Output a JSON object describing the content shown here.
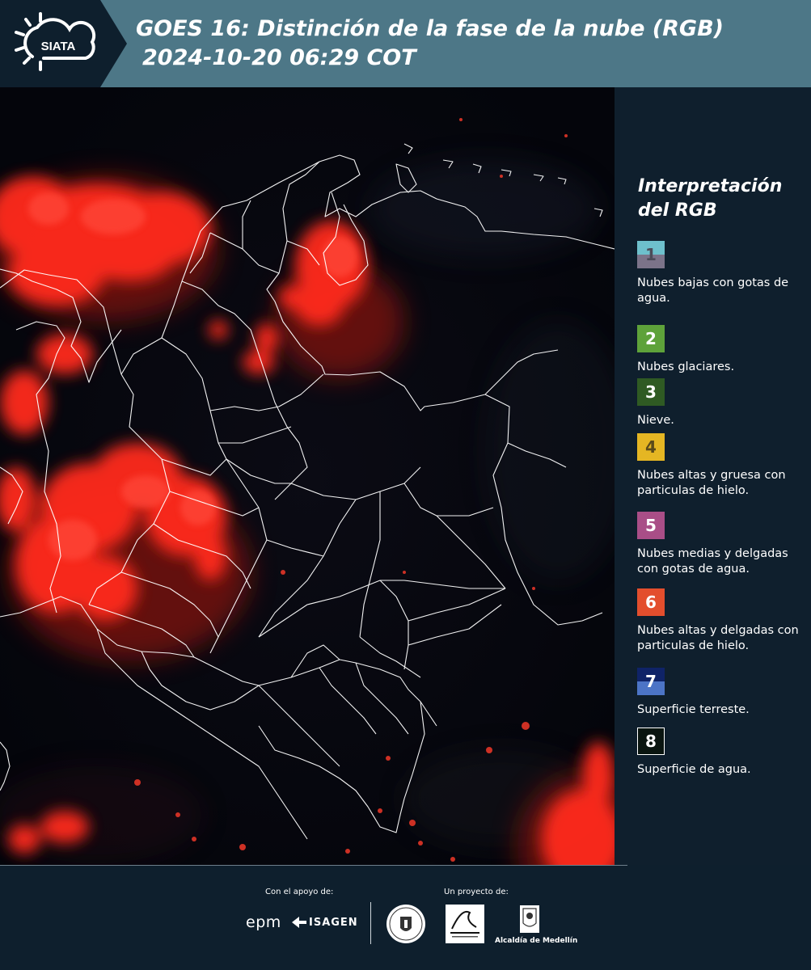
{
  "header": {
    "logo_text": "SIATA",
    "title": "GOES 16: Distinción de la fase de la nube (RGB)",
    "subtitle": "2024-10-20 06:29 COT"
  },
  "legend": {
    "title": "Interpretación del RGB",
    "items": [
      {
        "number": "1",
        "label": "Nubes bajas con gotas de agua.",
        "color_top": "#6ec0cc",
        "color_bottom": "#7b7389",
        "text_color": "#4b4b58"
      },
      {
        "number": "2",
        "label": "Nubes glaciares.",
        "color_top": "#5ea23a",
        "color_bottom": "#5ea23a",
        "text_color": "#ffffff"
      },
      {
        "number": "3",
        "label": "Nieve.",
        "color_top": "#2f5a23",
        "color_bottom": "#2f5a23",
        "text_color": "#ffffff"
      },
      {
        "number": "4",
        "label": "Nubes altas y gruesa con particulas de hielo.",
        "color_top": "#e5b623",
        "color_bottom": "#e5b623",
        "text_color": "#5a4a1a"
      },
      {
        "number": "5",
        "label": "Nubes medias y delgadas con gotas de agua.",
        "color_top": "#a94e87",
        "color_bottom": "#a94e87",
        "text_color": "#ffffff"
      },
      {
        "number": "6",
        "label": "Nubes altas y delgadas con particulas de hielo.",
        "color_top": "#e34e2d",
        "color_bottom": "#e34e2d",
        "text_color": "#ffffff"
      },
      {
        "number": "7",
        "label": "Superficie terreste.",
        "color_top": "#0f2367",
        "color_bottom": "#4c74c6",
        "text_color": "#ffffff"
      },
      {
        "number": "8",
        "label": "Superficie de agua.",
        "color_top": "#0a1510",
        "color_bottom": "#0a1510",
        "text_color": "#ffffff"
      }
    ]
  },
  "footer": {
    "support_label": "Con el apoyo de:",
    "project_label": "Un proyecto de:",
    "epm": "epm",
    "isagen": "ISAGEN",
    "alcaldia": "Alcaldía de Medellín"
  },
  "colors": {
    "header_bg": "#4d7787",
    "panel_bg": "#0f1f2d",
    "map_bg": "#05070e",
    "cloud_red": "#ff2a1c"
  }
}
